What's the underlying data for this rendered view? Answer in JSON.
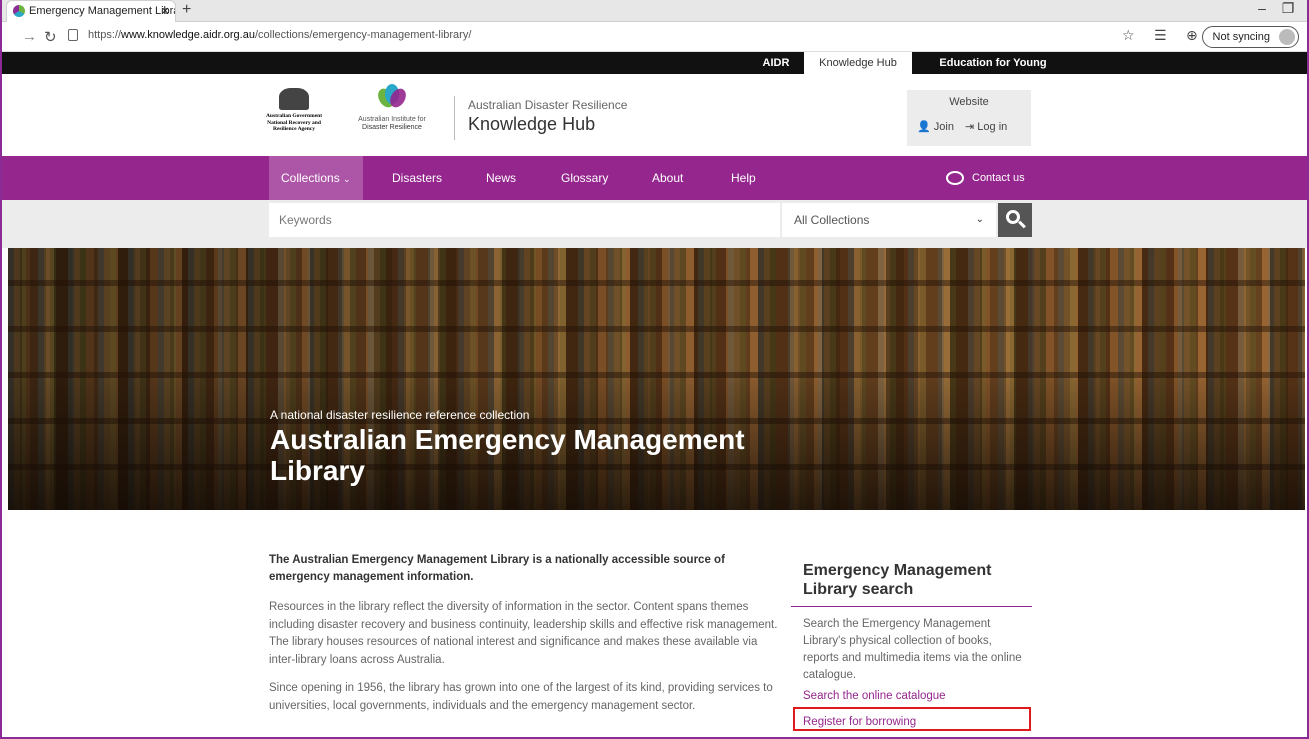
{
  "browser": {
    "tab_title": "Emergency Management Library",
    "tab_close": "×",
    "new_tab": "+",
    "url_prefix": "https://",
    "url_host": "www.knowledge.aidr.org.au",
    "url_path": "/collections/emergency-management-library/",
    "sync_label": "Not syncing",
    "back_icon": "back-arrow-icon",
    "reload_icon": "reload-icon"
  },
  "topbar": {
    "items": [
      "AIDR",
      "Knowledge Hub",
      "Education for Young People"
    ],
    "active": "Knowledge Hub"
  },
  "header": {
    "gov_lines": [
      "Australian Government",
      "National Recovery and",
      "Resilience Agency"
    ],
    "aidr_lines": [
      "Australian Institute for",
      "Disaster Resilience"
    ],
    "site_subtitle": "Australian Disaster Resilience",
    "site_title": "Knowledge Hub",
    "website_label": "Website",
    "join_label": "Join",
    "login_label": "Log in"
  },
  "nav": {
    "items": [
      "Collections",
      "Disasters",
      "News",
      "Glossary",
      "About",
      "Help"
    ],
    "active": "Collections",
    "contact_label": "Contact us"
  },
  "search": {
    "placeholder": "Keywords",
    "collection_selected": "All Collections"
  },
  "hero": {
    "kicker": "A national disaster resilience reference collection",
    "title": "Australian Emergency Management Library"
  },
  "content": {
    "intro": "The Australian Emergency Management Library is a nationally accessible source of emergency management information.",
    "para1": "Resources in the library reflect the diversity of information in the sector. Content spans themes including disaster recovery and business continuity, leadership skills and effective risk management. The library houses resources of national interest and significance and makes these available via inter-library loans across Australia.",
    "para2": "Since opening in 1956, the library has grown into one of the largest of its kind, providing services to universities, local governments, individuals and the emergency management sector."
  },
  "sidebar": {
    "title": "Emergency Management Library search",
    "text": "Search the Emergency Management Library's physical collection of books, reports and multimedia items via the online catalogue.",
    "link1": "Search the online catalogue",
    "link2": "Register for borrowing"
  },
  "colors": {
    "brand_purple": "#94268d",
    "highlight_red": "#e0191b",
    "topbar_black": "#111111"
  }
}
